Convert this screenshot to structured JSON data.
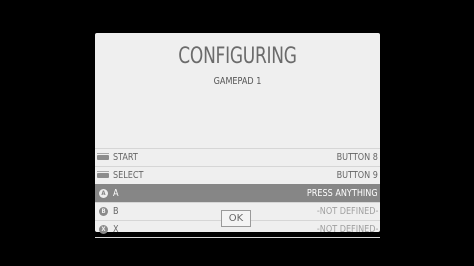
{
  "dialog": {
    "title": "CONFIGURING",
    "subtitle": "GAMEPAD 1"
  },
  "mappings": [
    {
      "icon": "start-button-icon",
      "label": "START",
      "value": "BUTTON 8",
      "state": "defined"
    },
    {
      "icon": "select-button-icon",
      "label": "SELECT",
      "value": "BUTTON 9",
      "state": "defined"
    },
    {
      "icon": "a-button-icon",
      "glyph": "A",
      "label": "A",
      "value": "PRESS ANYTHING",
      "state": "selected"
    },
    {
      "icon": "b-button-icon",
      "glyph": "B",
      "label": "B",
      "value": "-NOT DEFINED-",
      "state": "undefined"
    },
    {
      "icon": "x-button-icon",
      "glyph": "X",
      "label": "X",
      "value": "-NOT DEFINED-",
      "state": "undefined"
    }
  ],
  "actions": {
    "ok_label": "OK"
  },
  "colors": {
    "background": "#000000",
    "dialog": "#efefef",
    "selected_row": "#868686",
    "text": "#666666",
    "muted_text": "#a0a0a0"
  }
}
